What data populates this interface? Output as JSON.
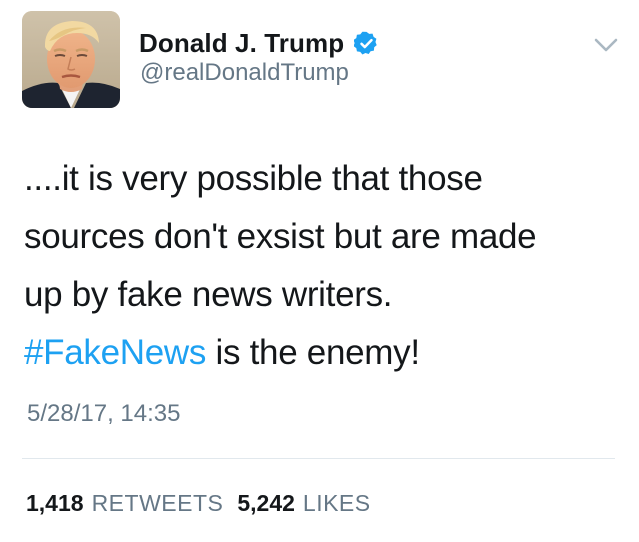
{
  "author": {
    "display_name": "Donald J. Trump",
    "handle": "@realDonaldTrump",
    "verified": true,
    "verified_icon": "verified-badge-icon",
    "avatar_icon": "profile-avatar"
  },
  "menu": {
    "icon": "chevron-down-icon"
  },
  "tweet": {
    "lines": [
      "....it is very possible that those",
      "sources don't exsist but are made",
      "up by fake news writers."
    ],
    "hashtag": "#FakeNews",
    "hashtag_tail": " is the enemy!",
    "timestamp": "5/28/17, 14:35"
  },
  "stats": {
    "retweets_count": "1,418",
    "retweets_label": "RETWEETS",
    "likes_count": "5,242",
    "likes_label": "LIKES"
  },
  "colors": {
    "text": "#14171a",
    "secondary": "#657786",
    "accent": "#1da1f2",
    "divider": "#e1e8ed"
  }
}
